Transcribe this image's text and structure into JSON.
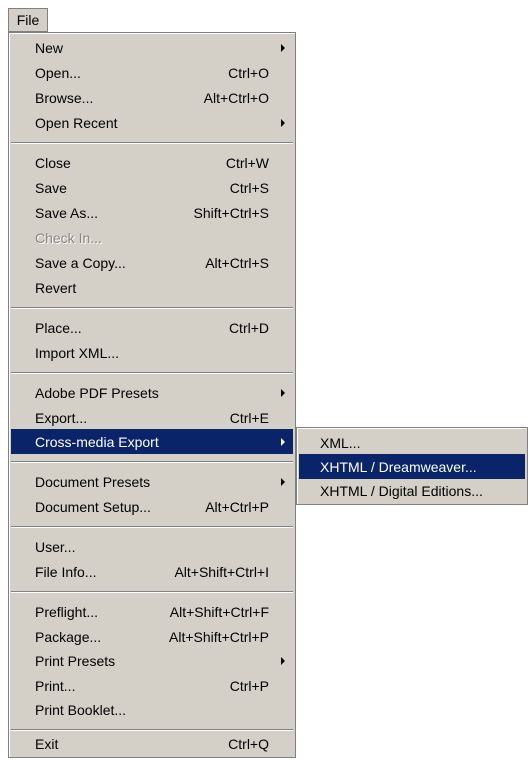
{
  "menubar": {
    "file_label": "File"
  },
  "file_menu": {
    "new": {
      "label": "New"
    },
    "open": {
      "label": "Open...",
      "shortcut": "Ctrl+O"
    },
    "browse": {
      "label": "Browse...",
      "shortcut": "Alt+Ctrl+O"
    },
    "open_recent": {
      "label": "Open Recent"
    },
    "close": {
      "label": "Close",
      "shortcut": "Ctrl+W"
    },
    "save": {
      "label": "Save",
      "shortcut": "Ctrl+S"
    },
    "save_as": {
      "label": "Save As...",
      "shortcut": "Shift+Ctrl+S"
    },
    "check_in": {
      "label": "Check In...",
      "disabled": true
    },
    "save_copy": {
      "label": "Save a Copy...",
      "shortcut": "Alt+Ctrl+S"
    },
    "revert": {
      "label": "Revert"
    },
    "place": {
      "label": "Place...",
      "shortcut": "Ctrl+D"
    },
    "import_xml": {
      "label": "Import XML..."
    },
    "pdf_presets": {
      "label": "Adobe PDF Presets"
    },
    "export": {
      "label": "Export...",
      "shortcut": "Ctrl+E"
    },
    "cross_media": {
      "label": "Cross-media Export",
      "highlighted": true
    },
    "document_presets": {
      "label": "Document Presets"
    },
    "document_setup": {
      "label": "Document Setup...",
      "shortcut": "Alt+Ctrl+P"
    },
    "user": {
      "label": "User..."
    },
    "file_info": {
      "label": "File Info...",
      "shortcut": "Alt+Shift+Ctrl+I"
    },
    "preflight": {
      "label": "Preflight...",
      "shortcut": "Alt+Shift+Ctrl+F"
    },
    "package": {
      "label": "Package...",
      "shortcut": "Alt+Shift+Ctrl+P"
    },
    "print_presets": {
      "label": "Print Presets"
    },
    "print": {
      "label": "Print...",
      "shortcut": "Ctrl+P"
    },
    "print_booklet": {
      "label": "Print Booklet..."
    },
    "exit": {
      "label": "Exit",
      "shortcut": "Ctrl+Q"
    }
  },
  "cross_media_submenu": {
    "xml": {
      "label": "XML..."
    },
    "xhtml_dreamweaver": {
      "label": "XHTML / Dreamweaver...",
      "highlighted": true
    },
    "xhtml_digital_editions": {
      "label": "XHTML / Digital Editions..."
    }
  },
  "colors": {
    "menu_background": "#d4d0c8",
    "highlight": "#0a246a",
    "highlight_text": "#ffffff",
    "disabled_text": "#8a8780"
  }
}
